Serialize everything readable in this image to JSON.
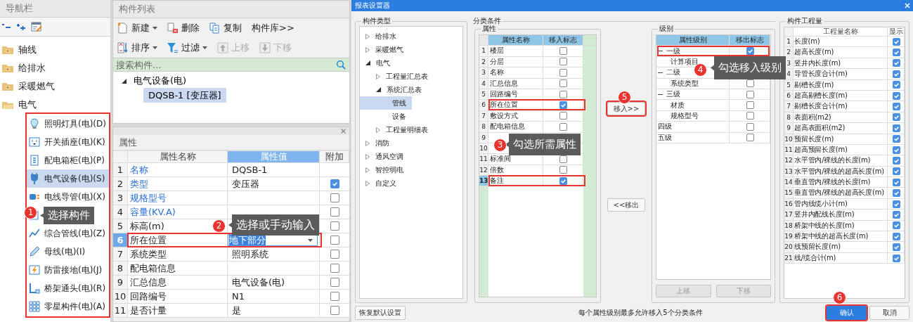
{
  "nav": {
    "title": "导航栏",
    "items": [
      {
        "label": "轴线",
        "expanded": false
      },
      {
        "label": "给排水",
        "expanded": false
      },
      {
        "label": "采暖燃气",
        "expanded": false
      },
      {
        "label": "电气",
        "expanded": true,
        "children_marked": true,
        "children": [
          {
            "label": "照明灯具(电)(D)",
            "selected": false
          },
          {
            "label": "开关插座(电)(K)",
            "selected": false
          },
          {
            "label": "配电箱柜(电)(P)",
            "selected": false
          },
          {
            "label": "电气设备(电)(S)",
            "selected": true
          },
          {
            "label": "电线导管(电)(X)",
            "selected": false
          },
          {
            "selected": false
          },
          {
            "label": "综合管线(电)(Z)",
            "selected": false
          },
          {
            "label": "母线(电)(I)",
            "selected": false
          },
          {
            "label": "防雷接地(电)(J)",
            "selected": false
          },
          {
            "label": "桥架通头(电)(R)",
            "selected": false
          },
          {
            "label": "零星构件(电)(A)",
            "selected": false
          }
        ]
      }
    ]
  },
  "component_list": {
    "title": "构件列表",
    "toolbar_rows": [
      [
        {
          "label": "新建",
          "dropdown": true,
          "disabled": false
        },
        {
          "label": "删除",
          "dropdown": false,
          "disabled": false
        },
        {
          "label": "复制",
          "dropdown": false,
          "disabled": false
        },
        {
          "label": "构件库>>",
          "dropdown": false,
          "disabled": false
        }
      ],
      [
        {
          "label": "排序",
          "dropdown": true,
          "disabled": false
        },
        {
          "label": "过滤",
          "dropdown": true,
          "disabled": false
        },
        {
          "label": "上移",
          "dropdown": false,
          "disabled": true
        },
        {
          "label": "下移",
          "dropdown": false,
          "disabled": true
        }
      ]
    ],
    "search": {
      "placeholder": "搜索构件..."
    },
    "tree": [
      {
        "label": "电气设备(电)",
        "expanded": true,
        "children": [
          {
            "label": "DQSB-1 [变压器]",
            "selected": true
          }
        ]
      }
    ]
  },
  "properties": {
    "title": "属性",
    "columns": [
      {
        "label": "属性名称",
        "selected": false
      },
      {
        "label": "属性值",
        "selected": true
      },
      {
        "label": "附加",
        "selected": false
      }
    ],
    "rows": [
      {
        "index": "1",
        "name": "名称",
        "value": "DQSB-1",
        "public": true,
        "selected": false,
        "marked": false
      },
      {
        "index": "2",
        "name": "类型",
        "value": "变压器",
        "public": true,
        "selected": false,
        "marked": false,
        "checked": true
      },
      {
        "index": "3",
        "name": "规格型号",
        "public": true,
        "selected": false,
        "marked": false,
        "checked": false
      },
      {
        "index": "4",
        "name": "容量(KV.A)",
        "public": true,
        "selected": false,
        "marked": false,
        "checked": false
      },
      {
        "index": "5",
        "name": "标高(m)",
        "public": false,
        "selected": false,
        "marked": false,
        "checked": false
      },
      {
        "index": "6",
        "name": "所在位置",
        "value": "地下部分",
        "public": false,
        "selected": true,
        "marked": true,
        "checked": false
      },
      {
        "index": "7",
        "name": "系统类型",
        "value": "照明系统",
        "public": false,
        "selected": false,
        "marked": false,
        "checked": false
      },
      {
        "index": "8",
        "name": "配电箱信息",
        "public": false,
        "selected": false,
        "marked": false,
        "checked": false
      },
      {
        "index": "9",
        "name": "汇总信息",
        "value": "电气设备(电)",
        "public": false,
        "selected": false,
        "marked": false,
        "checked": false
      },
      {
        "index": "10",
        "name": "回路编号",
        "value": "N1",
        "public": false,
        "selected": false,
        "marked": false,
        "checked": false
      },
      {
        "index": "11",
        "name": "是否计量",
        "value": "是",
        "public": false,
        "selected": false,
        "marked": false,
        "checked": false
      }
    ]
  },
  "dialog": {
    "title": "报表设置器",
    "component_types": {
      "title": "构件类型",
      "items": [
        {
          "label": "给排水",
          "expanded": false,
          "selected": false
        },
        {
          "label": "采暖燃气",
          "expanded": false,
          "selected": false
        },
        {
          "label": "电气",
          "expanded": true,
          "selected": false,
          "children": [
            {
              "label": "工程量汇总表",
              "expanded": false,
              "selected": false
            },
            {
              "label": "系统汇总表",
              "expanded": true,
              "selected": false,
              "children": [
                {
                  "label": "管线",
                  "selected": true
                },
                {
                  "label": "设备",
                  "selected": false
                }
              ]
            },
            {
              "label": "工程量明细表",
              "expanded": false,
              "selected": false
            }
          ]
        },
        {
          "label": "消防",
          "expanded": false,
          "selected": false
        },
        {
          "label": "通风空调",
          "expanded": false,
          "selected": false
        },
        {
          "label": "智控弱电",
          "expanded": false,
          "selected": false
        },
        {
          "label": "自定义",
          "expanded": false,
          "selected": false
        }
      ]
    },
    "conditions": {
      "title": "分类条件",
      "attributes": {
        "title": "属性",
        "columns": [
          "属性名称",
          "移入标志"
        ],
        "rows": [
          {
            "index": "1",
            "name": "楼层",
            "checked": false,
            "selected": false,
            "marked": false
          },
          {
            "index": "2",
            "name": "分层",
            "checked": false,
            "selected": false,
            "marked": false
          },
          {
            "index": "3",
            "name": "名称",
            "checked": false,
            "selected": false,
            "marked": false
          },
          {
            "index": "4",
            "name": "汇总信息",
            "checked": false,
            "selected": false,
            "marked": false
          },
          {
            "index": "5",
            "name": "回路编号",
            "checked": false,
            "selected": false,
            "marked": false
          },
          {
            "index": "6",
            "name": "所在位置",
            "checked": true,
            "selected": false,
            "marked": true
          },
          {
            "index": "7",
            "name": "敷设方式",
            "checked": false,
            "selected": false,
            "marked": false
          },
          {
            "index": "8",
            "name": "配电箱信息",
            "checked": false,
            "selected": false,
            "marked": false
          },
          {
            "index": "9",
            "selected": false,
            "marked": false
          },
          {
            "index": "10",
            "selected": false,
            "marked": false
          },
          {
            "index": "11",
            "name": "标准间",
            "checked": false,
            "selected": false,
            "marked": false
          },
          {
            "index": "12",
            "name": "倍数",
            "checked": false,
            "selected": false,
            "marked": false
          },
          {
            "index": "13",
            "name": "备注",
            "checked": true,
            "selected": true,
            "marked": true
          }
        ]
      },
      "move_buttons": [
        {
          "label": "移入>>",
          "marked": true
        },
        {
          "label": "<<移出",
          "marked": false
        }
      ],
      "levels": {
        "title": "级别",
        "columns": [
          "属性级别",
          "移出标志"
        ],
        "rows": [
          {
            "name": "一级",
            "checked": true,
            "marked": true,
            "expanded": true,
            "children": [
              {
                "name": "计算项目"
              }
            ]
          },
          {
            "name": "二级",
            "marked": false,
            "expanded": true,
            "children": [
              {
                "name": "系统类型",
                "checked": false
              }
            ]
          },
          {
            "name": "三级",
            "checked": false,
            "marked": false,
            "expanded": true,
            "children": [
              {
                "name": "材质",
                "checked": false
              },
              {
                "name": "规格型号",
                "checked": false
              }
            ]
          },
          {
            "name": "四级",
            "checked": false,
            "marked": false
          },
          {
            "name": "五级",
            "checked": false,
            "marked": false
          }
        ],
        "buttons": [
          {
            "label": "上移",
            "disabled": true
          },
          {
            "label": "下移",
            "disabled": true
          }
        ]
      }
    },
    "quantities": {
      "title": "构件工程量",
      "columns": [
        "工程量名称",
        "显示"
      ],
      "rows": [
        {
          "index": "1",
          "name": "长度(m)",
          "checked": true
        },
        {
          "index": "2",
          "name": "超高长度(m)",
          "checked": true
        },
        {
          "index": "3",
          "name": "竖井内长度(m)",
          "checked": true
        },
        {
          "index": "4",
          "name": "导管长度合计(m)",
          "checked": true
        },
        {
          "index": "5",
          "name": "剔槽长度(m)",
          "checked": true
        },
        {
          "index": "6",
          "name": "超高剔槽长度(m)",
          "checked": true
        },
        {
          "index": "7",
          "name": "剔槽长度合计(m)",
          "checked": true
        },
        {
          "index": "8",
          "name": "表面积(m2)",
          "checked": true
        },
        {
          "index": "9",
          "name": "超高表面积(m2)",
          "checked": true
        },
        {
          "index": "10",
          "name": "预留长度(m)",
          "checked": true
        },
        {
          "index": "11",
          "name": "超高预留长度(m)",
          "checked": true
        },
        {
          "index": "12",
          "name": "水平管内/裸线的长度(m)",
          "checked": true
        },
        {
          "index": "13",
          "name": "水平管内/裸线的超高长度(m)",
          "checked": true
        },
        {
          "index": "14",
          "name": "垂直管内/裸线的长度(m)",
          "checked": true
        },
        {
          "index": "15",
          "name": "垂直管内/裸线的超高长度(m)",
          "checked": true
        },
        {
          "index": "16",
          "name": "管内线缆小计(m)",
          "checked": true
        },
        {
          "index": "17",
          "name": "竖井内配线长度(m)",
          "checked": true
        },
        {
          "index": "18",
          "name": "桥架中线的长度(m)",
          "checked": true
        },
        {
          "index": "19",
          "name": "桥架中线的超高长度(m)",
          "checked": true
        },
        {
          "index": "20",
          "name": "线预留长度(m)",
          "checked": true
        },
        {
          "index": "21",
          "name": "线/缆合计(m)",
          "checked": true
        }
      ]
    },
    "footer": {
      "reset_button": "恢复默认设置",
      "message": "每个属性级别最多允许移入5个分类条件",
      "buttons": [
        {
          "label": "确认",
          "primary": true,
          "marked": true
        },
        {
          "label": "取消",
          "primary": false,
          "marked": false
        }
      ]
    }
  },
  "annotations": [
    {
      "number": "1",
      "text": "选择构件"
    },
    {
      "number": "2",
      "text": "选择或手动输入"
    },
    {
      "number": "3",
      "text": "勾选所需属性"
    },
    {
      "number": "4",
      "text": "勾选移入级别"
    },
    {
      "number": "5"
    },
    {
      "number": "6"
    }
  ]
}
